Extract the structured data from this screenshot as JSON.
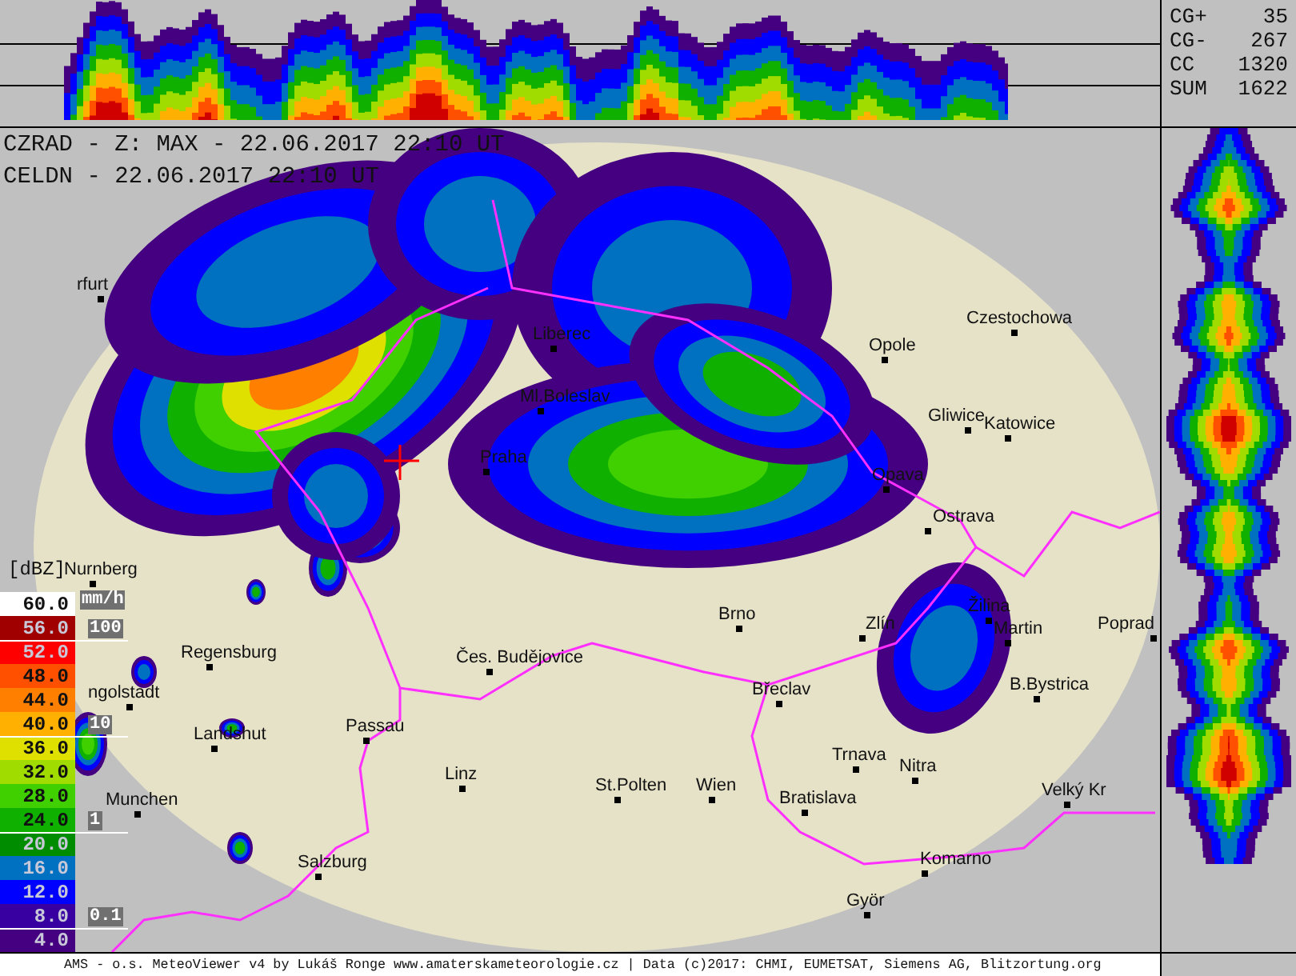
{
  "lightning_stats": [
    {
      "label": "CG+",
      "value": "35"
    },
    {
      "label": "CG-",
      "value": "267"
    },
    {
      "label": "CC",
      "value": "1320"
    },
    {
      "label": "SUM",
      "value": "1622"
    }
  ],
  "map": {
    "header_lines": [
      "CZRAD - Z: MAX - 22.06.2017 22:10 UT",
      "CELDN - 22.06.2017 22:10 UT"
    ],
    "cities": [
      {
        "name": "rfurt"
      },
      {
        "name": "Liberec"
      },
      {
        "name": "Ml.Boleslav"
      },
      {
        "name": "Praha"
      },
      {
        "name": "Nurnberg"
      },
      {
        "name": "Regensburg"
      },
      {
        "name": "ngolstadt"
      },
      {
        "name": "Landshut"
      },
      {
        "name": "Passau"
      },
      {
        "name": "Munchen"
      },
      {
        "name": "Linz"
      },
      {
        "name": "St.Polten"
      },
      {
        "name": "Salzburg"
      },
      {
        "name": "Čes. Budějovice"
      },
      {
        "name": "Czestochowa"
      },
      {
        "name": "Opole"
      },
      {
        "name": "Gliwice"
      },
      {
        "name": "Katowice"
      },
      {
        "name": "Opava"
      },
      {
        "name": "Ostrava"
      },
      {
        "name": "Brno"
      },
      {
        "name": "Zlín"
      },
      {
        "name": "Žilina"
      },
      {
        "name": "Martin"
      },
      {
        "name": "Poprad"
      },
      {
        "name": "Břeclav"
      },
      {
        "name": "B.Bystrica"
      },
      {
        "name": "Trnava"
      },
      {
        "name": "Nitra"
      },
      {
        "name": "Wien"
      },
      {
        "name": "Bratislava"
      },
      {
        "name": "Komarno"
      },
      {
        "name": "Györ"
      },
      {
        "name": "Velký Kr"
      }
    ],
    "legend": {
      "unit": "[dBZ]",
      "rain_unit": "mm/h",
      "levels": [
        {
          "label": "60.0",
          "color": "#ffffff"
        },
        {
          "label": "56.0",
          "color": "#a00000"
        },
        {
          "label": "52.0",
          "color": "#ff0000"
        },
        {
          "label": "48.0",
          "color": "#ff5000"
        },
        {
          "label": "44.0",
          "color": "#ff8000"
        },
        {
          "label": "40.0",
          "color": "#ffb000"
        },
        {
          "label": "36.0",
          "color": "#e0e000"
        },
        {
          "label": "32.0",
          "color": "#a0dc00"
        },
        {
          "label": "28.0",
          "color": "#40d000"
        },
        {
          "label": "24.0",
          "color": "#10b000"
        },
        {
          "label": "20.0",
          "color": "#008c00"
        },
        {
          "label": "16.0",
          "color": "#0070c0"
        },
        {
          "label": "12.0",
          "color": "#0000ff"
        },
        {
          "label": "8.0",
          "color": "#3800a0"
        },
        {
          "label": "4.0",
          "color": "#440080"
        }
      ],
      "rain_rates": [
        "100",
        "10",
        "1",
        "0.1"
      ]
    }
  },
  "footer": "AMS - o.s. MeteoViewer v4 by Lukáš Ronge www.amaterskameteorologie.cz | Data (c)2017: CHMI, EUMETSAT, Siemens AG, Blitzortung.org"
}
